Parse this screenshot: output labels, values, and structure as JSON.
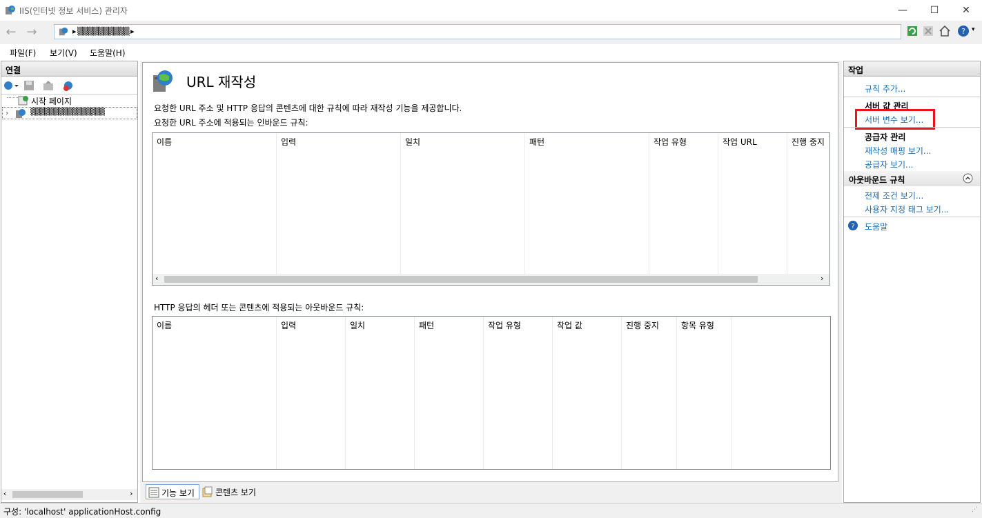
{
  "window": {
    "title": "IIS(인터넷 정보 서비스) 관리자",
    "minimize": "—",
    "maximize": "☐",
    "close": "✕"
  },
  "address": {
    "back": "←",
    "forward": "→",
    "path": "▸ ▒▒▒▒▒▒▒▒▒▒ ▸"
  },
  "menu": {
    "file": "파일(F)",
    "view": "보기(V)",
    "help": "도움말(H)"
  },
  "connections": {
    "header": "연결",
    "tree": [
      {
        "label": "시작 페이지"
      },
      {
        "label": "▒▒▒▒▒▒▒▒▒▒▒▒▒▒▒▒"
      }
    ]
  },
  "feature": {
    "title": "URL 재작성",
    "description": "요청한 URL 주소 및 HTTP 응답의 콘텐츠에 대한 규칙에 따라 재작성 기능을 제공합니다.",
    "inbound_label": "요청한 URL 주소에 적용되는 인바운드 규칙:",
    "inbound_columns": [
      "이름",
      "입력",
      "일치",
      "패턴",
      "작업 유형",
      "작업 URL",
      "진행 중지"
    ],
    "outbound_label": "HTTP 응답의 헤더 또는 콘텐츠에 적용되는 아웃바운드 규칙:",
    "outbound_columns": [
      "이름",
      "입력",
      "일치",
      "패턴",
      "작업 유형",
      "작업 값",
      "진행 중지",
      "항목 유형"
    ],
    "tab_feature": "기능 보기",
    "tab_content": "콘텐츠 보기"
  },
  "actions": {
    "header": "작업",
    "add_rule": "규칙 추가...",
    "server_var_heading": "서버 값 관리",
    "server_var_view": "서버 변수 보기...",
    "provider_heading": "공급자 관리",
    "rewrite_map": "재작성 매핑 보기...",
    "provider_view": "공급자 보기...",
    "outbound_heading": "아웃바운드 규칙",
    "precondition": "전제 조건 보기...",
    "custom_tags": "사용자 지정 태그 보기...",
    "help": "도움말",
    "highlight_color": "#e8131f"
  },
  "status": {
    "text": "구성: 'localhost' applicationHost.config"
  }
}
